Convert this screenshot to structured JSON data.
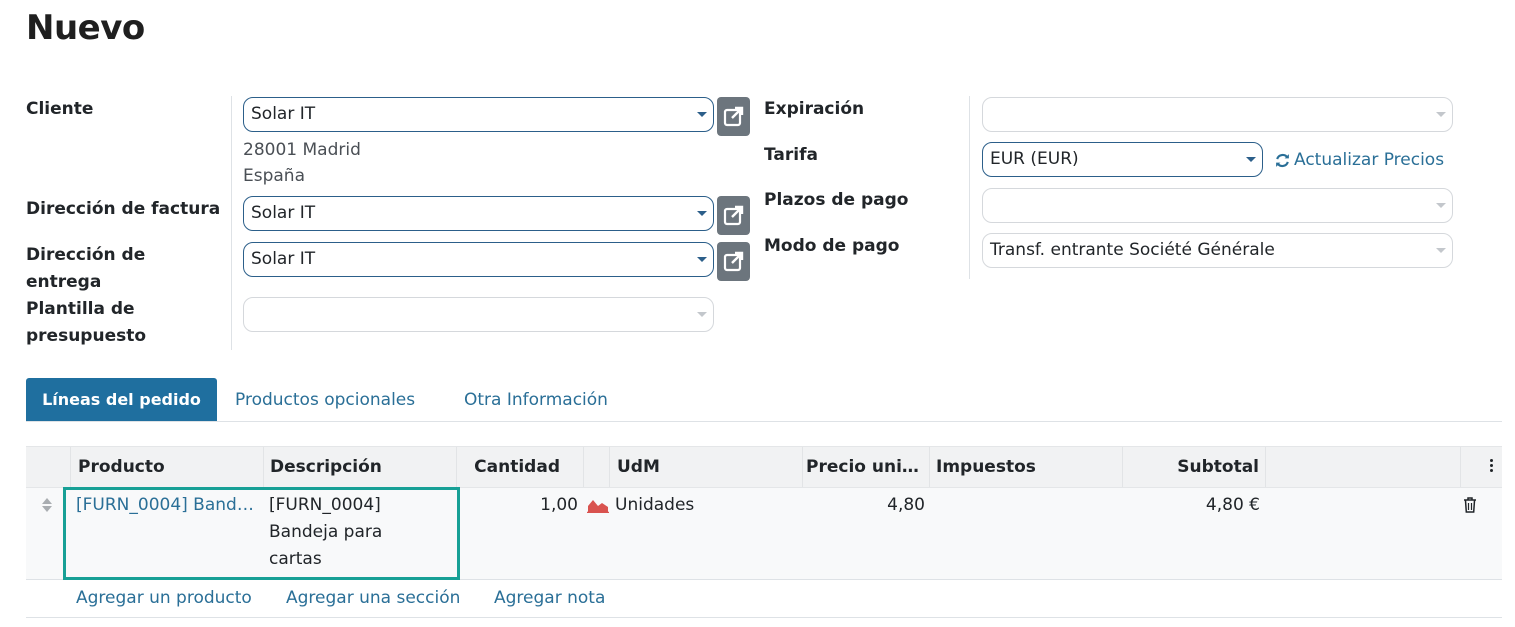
{
  "page": {
    "title": "Nuevo"
  },
  "left_fields": {
    "customer": {
      "label": "Cliente",
      "value": "Solar IT",
      "address_line1": "28001 Madrid",
      "address_line2": "España"
    },
    "invoice_address": {
      "label": "Dirección de factura",
      "value": "Solar IT"
    },
    "delivery_address": {
      "label_line1": "Dirección de",
      "label_line2": "entrega",
      "value": "Solar IT"
    },
    "quotation_template": {
      "label_line1": "Plantilla de",
      "label_line2": "presupuesto",
      "value": ""
    }
  },
  "right_fields": {
    "expiration": {
      "label": "Expiración",
      "value": ""
    },
    "pricelist": {
      "label": "Tarifa",
      "value": "EUR (EUR)",
      "update_link": "Actualizar Precios"
    },
    "payment_terms": {
      "label": "Plazos de pago",
      "value": ""
    },
    "payment_mode": {
      "label": "Modo de pago",
      "value": "Transf. entrante Société Générale"
    }
  },
  "tabs": [
    {
      "label": "Líneas del pedido",
      "active": true
    },
    {
      "label": "Productos opcionales",
      "active": false
    },
    {
      "label": "Otra Información",
      "active": false
    }
  ],
  "table": {
    "headers": {
      "product": "Producto",
      "description": "Descripción",
      "quantity": "Cantidad",
      "uom": "UdM",
      "unit_price": "Precio unit…",
      "taxes": "Impuestos",
      "subtotal": "Subtotal"
    },
    "rows": [
      {
        "product": "[FURN_0004] Band…",
        "description_line1": "[FURN_0004]",
        "description_line2": "Bandeja para",
        "description_line3": "cartas",
        "quantity": "1,00",
        "uom": "Unidades",
        "unit_price": "4,80",
        "taxes": "",
        "subtotal": "4,80 €"
      }
    ],
    "add_links": {
      "product": "Agregar un producto",
      "section": "Agregar una sección",
      "note": "Agregar nota"
    }
  },
  "colors": {
    "primary": "#1f6f9f",
    "link": "#2a6f97",
    "highlight": "#17a096",
    "forecast_icon": "#d9534f"
  }
}
